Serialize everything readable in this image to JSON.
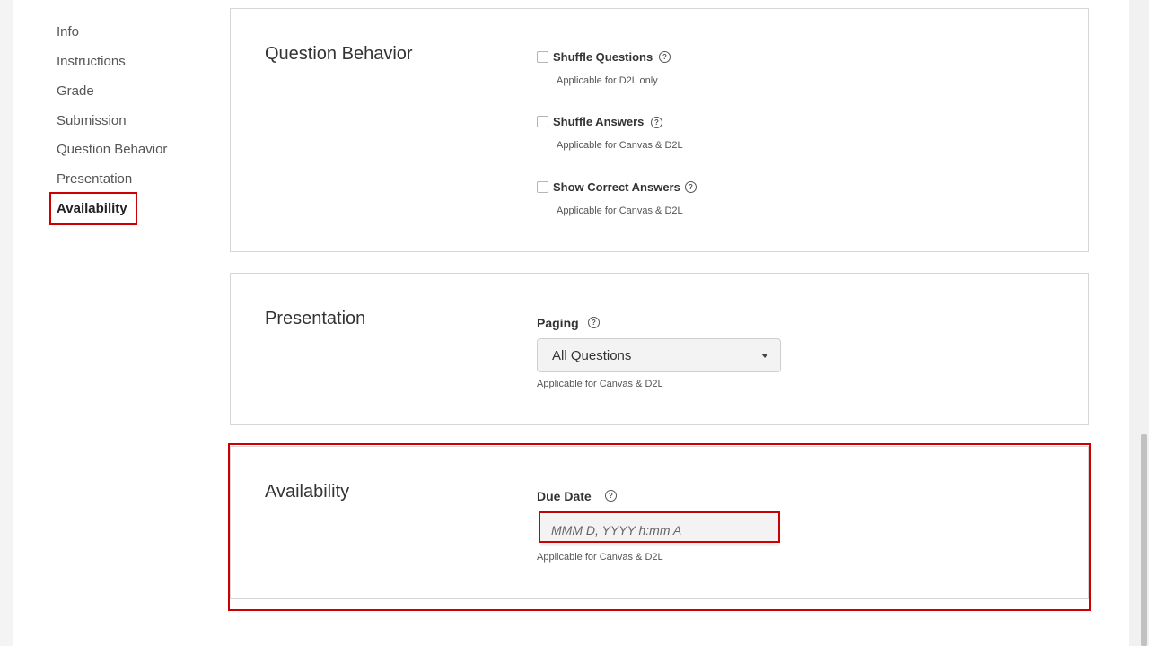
{
  "sidebar": {
    "items": [
      {
        "label": "Info"
      },
      {
        "label": "Instructions"
      },
      {
        "label": "Grade"
      },
      {
        "label": "Submission"
      },
      {
        "label": "Question Behavior"
      },
      {
        "label": "Presentation"
      },
      {
        "label": "Availability"
      }
    ],
    "active": "Availability"
  },
  "question_behavior": {
    "title": "Question Behavior",
    "options": [
      {
        "label": "Shuffle Questions",
        "hint": "Applicable for D2L only",
        "checked": false
      },
      {
        "label": "Shuffle Answers",
        "hint": "Applicable for Canvas & D2L",
        "checked": false
      },
      {
        "label": "Show Correct Answers",
        "hint": "Applicable for Canvas & D2L",
        "checked": false
      }
    ]
  },
  "presentation": {
    "title": "Presentation",
    "paging_label": "Paging",
    "paging_value": "All Questions",
    "hint": "Applicable for Canvas & D2L"
  },
  "availability": {
    "title": "Availability",
    "due_date_label": "Due Date",
    "due_date_placeholder": "MMM D, YYYY h:mm A",
    "hint": "Applicable for Canvas & D2L"
  },
  "icons": {
    "help": "question-circle-icon",
    "dropdown": "caret-down-icon"
  },
  "colors": {
    "highlight": "#cc0000",
    "border": "#d6d6d6"
  }
}
